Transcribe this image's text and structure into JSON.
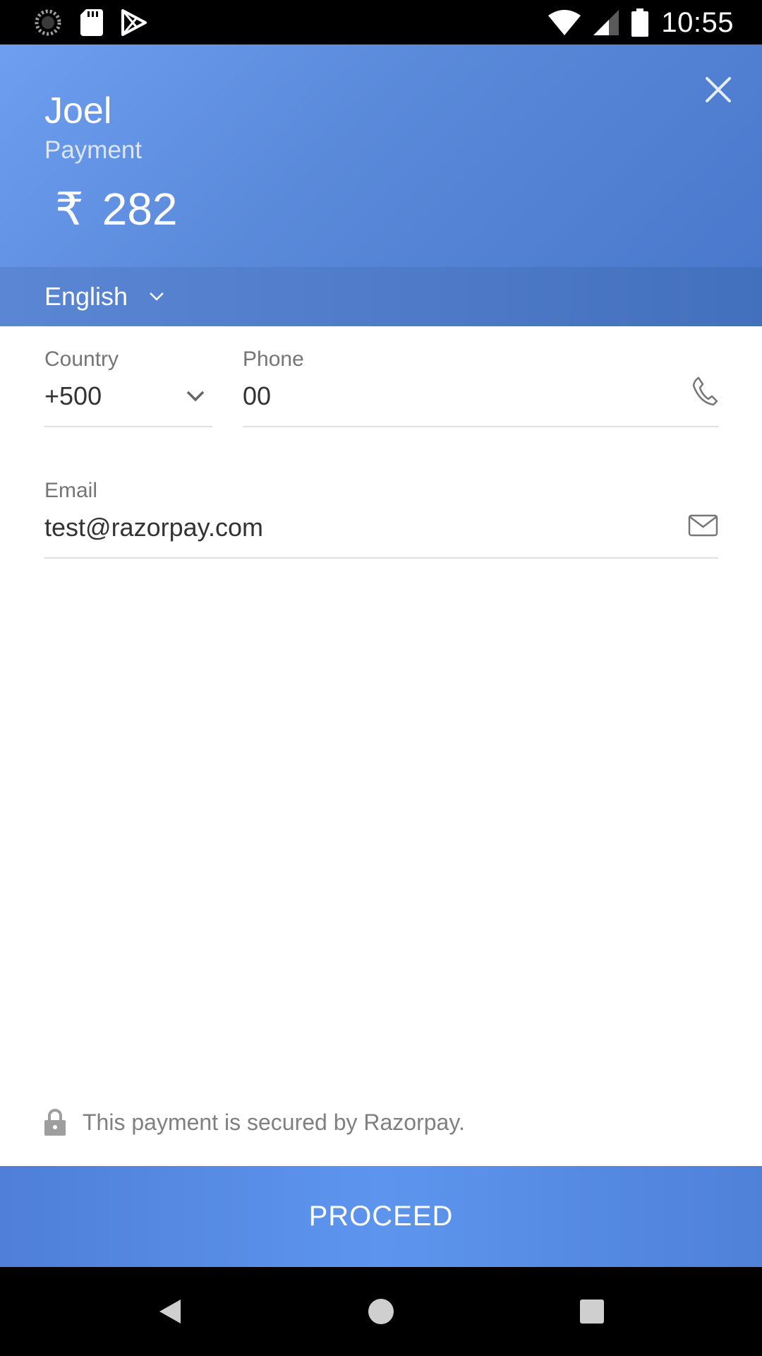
{
  "status_bar": {
    "time": "10:55",
    "icons": [
      "loading-icon",
      "sd-card-icon",
      "play-store-icon",
      "wifi-icon",
      "signal-icon",
      "battery-icon"
    ]
  },
  "header": {
    "merchant_name": "Joel",
    "description": "Payment",
    "currency_symbol": "₹",
    "amount": "282",
    "close_icon": "close-icon"
  },
  "language": {
    "selected": "English"
  },
  "form": {
    "country_label": "Country",
    "country_value": "+500",
    "phone_label": "Phone",
    "phone_value": "00",
    "email_label": "Email",
    "email_value": "test@razorpay.com"
  },
  "footer": {
    "secure_text": "This payment is secured by Razorpay.",
    "proceed_label": "PROCEED"
  },
  "colors": {
    "header_blue": "#5a89da",
    "button_blue": "#5d95ee",
    "label_gray": "#757575"
  }
}
